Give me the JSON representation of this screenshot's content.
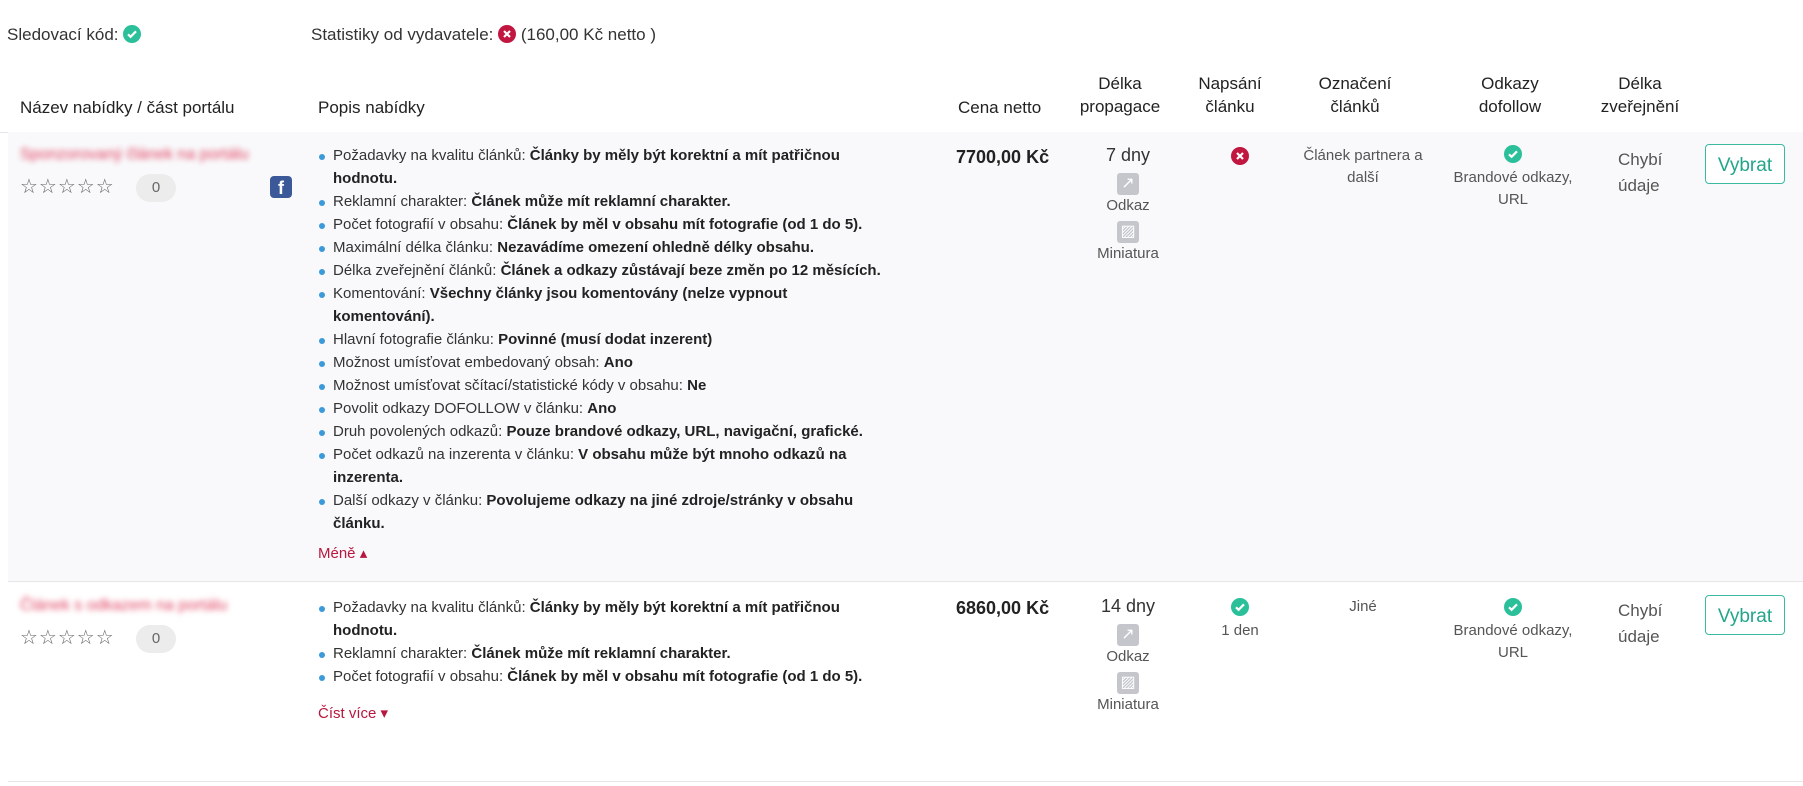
{
  "top": {
    "tracking_label": "Sledovací kód:",
    "stats_label": "Statistiky od vydavatele:",
    "stats_value": "(160,00 Kč netto )"
  },
  "headers": {
    "name": "Název nabídky / část portálu",
    "desc": "Popis nabídky",
    "price": "Cena netto",
    "promo_l1": "Délka",
    "promo_l2": "propagace",
    "writing_l1": "Napsání",
    "writing_l2": "článku",
    "marking_l1": "Označení",
    "marking_l2": "článků",
    "dofollow_l1": "Odkazy",
    "dofollow_l2": "dofollow",
    "publish_l1": "Délka",
    "publish_l2": "zveřejnění"
  },
  "rows": [
    {
      "name": "Sponzorovaný článek na portálu",
      "rating": "0",
      "stars": "☆☆☆☆☆",
      "price": "7700,00 Kč",
      "promo_days": "7 dny",
      "link_label": "Odkaz",
      "thumb_label": "Miniatura",
      "writing": "",
      "marking": "Článek partnera a další",
      "dofollow": "Brandové odkazy, URL",
      "publish_l1": "Chybí",
      "publish_l2": "údaje",
      "button": "Vybrat",
      "toggle": "Méně ▴",
      "desc": [
        {
          "k": "Požadavky na kvalitu článků: ",
          "v": "Články by měly být korektní a mít patřičnou hodnotu."
        },
        {
          "k": "Reklamní charakter: ",
          "v": "Článek může mít reklamní charakter."
        },
        {
          "k": "Počet fotografií v obsahu: ",
          "v": "Článek by měl v obsahu mít fotografie (od 1 do 5)."
        },
        {
          "k": "Maximální délka článku: ",
          "v": "Nezavádíme omezení ohledně délky obsahu."
        },
        {
          "k": "Délka zveřejnění článků: ",
          "v": "Článek a odkazy zůstávají beze změn po 12 měsících."
        },
        {
          "k": "Komentování: ",
          "v": "Všechny články jsou komentovány (nelze vypnout komentování)."
        },
        {
          "k": "Hlavní fotografie článku: ",
          "v": "Povinné (musí dodat inzerent)"
        },
        {
          "k": "Možnost umísťovat embedovaný obsah: ",
          "v": "Ano"
        },
        {
          "k": "Možnost umísťovat sčítací/statistické kódy v obsahu: ",
          "v": "Ne"
        },
        {
          "k": "Povolit odkazy DOFOLLOW v článku: ",
          "v": "Ano"
        },
        {
          "k": "Druh povolených odkazů: ",
          "v": "Pouze brandové odkazy, URL, navigační, grafické."
        },
        {
          "k": "Počet odkazů na inzerenta v článku: ",
          "v": "V obsahu může být mnoho odkazů na inzerenta."
        },
        {
          "k": "Další odkazy v článku: ",
          "v": "Povolujeme odkazy na jiné zdroje/stránky v obsahu článku."
        }
      ]
    },
    {
      "name": "Článek s odkazem na portálu",
      "rating": "0",
      "stars": "☆☆☆☆☆",
      "price": "6860,00 Kč",
      "promo_days": "14 dny",
      "link_label": "Odkaz",
      "thumb_label": "Miniatura",
      "writing": "1 den",
      "marking": "Jiné",
      "dofollow": "Brandové odkazy, URL",
      "publish_l1": "Chybí",
      "publish_l2": "údaje",
      "button": "Vybrat",
      "toggle": "Číst více ▾",
      "desc": [
        {
          "k": "Požadavky na kvalitu článků: ",
          "v": "Články by měly být korektní a mít patřičnou hodnotu."
        },
        {
          "k": "Reklamní charakter: ",
          "v": "Článek může mít reklamní charakter."
        },
        {
          "k": "Počet fotografií v obsahu: ",
          "v": "Článek by měl v obsahu mít fotografie (od 1 do 5)."
        }
      ]
    }
  ],
  "colors": {
    "success": "#2bbf9a",
    "error": "#c0163f",
    "accent": "#23a58b"
  }
}
